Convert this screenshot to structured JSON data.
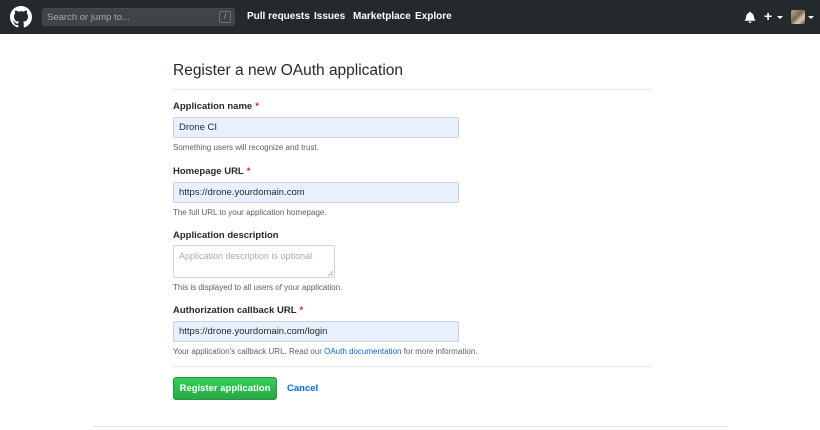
{
  "header": {
    "search_placeholder": "Search or jump to...",
    "search_shortcut": "/",
    "nav": [
      "Pull requests",
      "Issues",
      "Marketplace",
      "Explore"
    ],
    "new_menu_symbol": "+",
    "icons": [
      "github-logo-icon",
      "bell-icon",
      "plus-icon",
      "avatar"
    ]
  },
  "page": {
    "title": "Register a new OAuth application"
  },
  "form": {
    "app_name": {
      "label": "Application name",
      "required": "*",
      "value": "Drone CI",
      "hint": "Something users will recognize and trust."
    },
    "homepage": {
      "label": "Homepage URL",
      "required": "*",
      "value": "https://drone.yourdomain.com",
      "hint": "The full URL to your application homepage."
    },
    "description": {
      "label": "Application description",
      "placeholder": "Application description is optional",
      "hint": "This is displayed to all users of your application."
    },
    "callback": {
      "label": "Authorization callback URL",
      "required": "*",
      "value": "https://drone.yourdomain.com/login",
      "hint_before": "Your application's callback URL. Read our ",
      "hint_link": "OAuth documentation",
      "hint_after": " for more information."
    }
  },
  "actions": {
    "register_label": "Register application",
    "cancel_label": "Cancel"
  },
  "colors": {
    "header_bg": "#24292e",
    "primary_button": "#28a745",
    "link": "#0366d6",
    "required": "#cb2431",
    "autofill_bg": "#e8f0fe"
  }
}
